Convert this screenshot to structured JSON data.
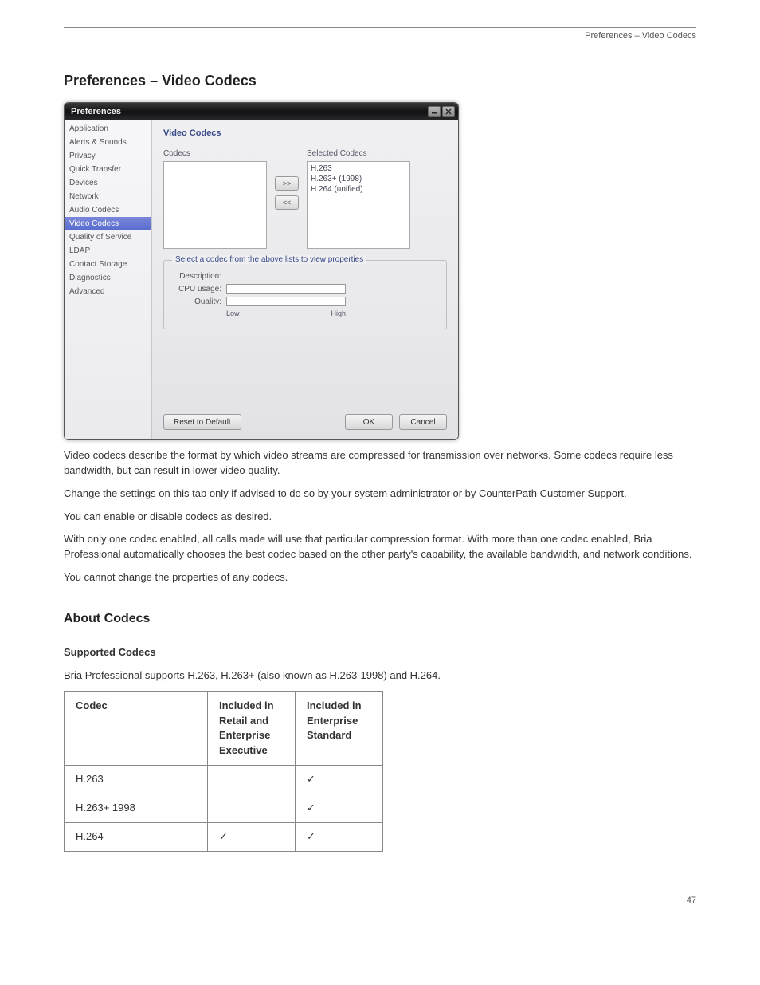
{
  "header": {
    "left": "",
    "right": "Preferences – Video Codecs"
  },
  "doc": {
    "title": "Preferences – Video Codecs",
    "p1": "Video codecs describe the format by which video streams are compressed for transmission over networks. Some codecs require less bandwidth, but can result in lower video quality.",
    "p2": "Change the settings on this tab only if advised to do so by your system administrator or by CounterPath Customer Support.",
    "p3": "You can enable or disable codecs as desired.",
    "p4": "With only one codec enabled, all calls made will use that particular compression format. With more than one codec enabled, Bria Professional automatically chooses the best codec based on the other party's capability, the available bandwidth, and network conditions.",
    "p5": "You cannot change the properties of any codecs.",
    "about_title": "About Codecs",
    "supported_title": "Supported Codecs",
    "supported_text": "Bria Professional supports H.263, H.263+ (also known as H.263-1998) and H.264."
  },
  "window": {
    "title": "Preferences",
    "sidebar": {
      "items": [
        "Application",
        "Alerts & Sounds",
        "Privacy",
        "Quick Transfer",
        "Devices",
        "Network",
        "Audio Codecs",
        "Video Codecs",
        "Quality of Service",
        "LDAP",
        "Contact Storage",
        "Diagnostics",
        "Advanced"
      ],
      "activeIndex": 7
    },
    "main": {
      "title": "Video Codecs",
      "codecs_label": "Codecs",
      "selected_label": "Selected Codecs",
      "selected": [
        "H.263",
        "H.263+ (1998)",
        "H.264 (unified)"
      ],
      "move_right": ">>",
      "move_left": "<<",
      "fieldset_legend": "Select a codec from the above lists to view properties",
      "description_label": "Description:",
      "cpu_label": "CPU usage:",
      "quality_label": "Quality:",
      "scale_low": "Low",
      "scale_high": "High",
      "reset_label": "Reset to Default",
      "ok_label": "OK",
      "cancel_label": "Cancel"
    }
  },
  "table": {
    "h0": "Codec",
    "h1_line1": "Included in",
    "h1_line2": "Retail and",
    "h1_line3": "Enterprise",
    "h1_line4": "Executive",
    "h2_line1": "Included in",
    "h2_line2": "Enterprise",
    "h2_line3": "Standard",
    "rows": [
      {
        "name": "H.263",
        "c1": "",
        "c2": "✓"
      },
      {
        "name": "H.263+ 1998",
        "c1": "",
        "c2": "✓"
      },
      {
        "name": "H.264",
        "c1": "✓",
        "c2": "✓"
      }
    ]
  },
  "footer": {
    "page": "47"
  }
}
